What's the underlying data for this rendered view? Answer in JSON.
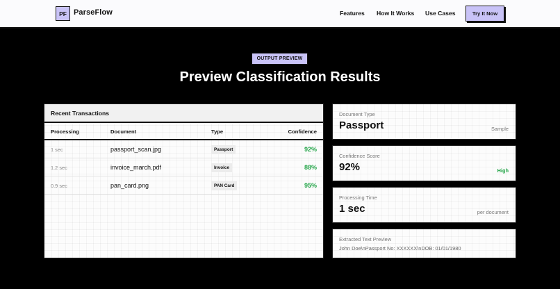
{
  "nav": {
    "logo_initials": "PF",
    "brand": "ParseFlow",
    "links": [
      "Features",
      "How It Works",
      "Use Cases"
    ],
    "cta_label": "Try It Now"
  },
  "hero": {
    "badge": "OUTPUT PREVIEW",
    "title": "Preview Classification Results"
  },
  "table": {
    "title": "Recent Transactions",
    "headers": [
      "Processing",
      "Document",
      "Type",
      "Confidence"
    ],
    "rows": [
      {
        "processing": "1 sec",
        "document": "passport_scan.jpg",
        "type": "Passport",
        "confidence": "92%"
      },
      {
        "processing": "1.2 sec",
        "document": "invoice_march.pdf",
        "type": "Invoice",
        "confidence": "88%"
      },
      {
        "processing": "0.9 sec",
        "document": "pan_card.png",
        "type": "PAN Card",
        "confidence": "95%"
      }
    ]
  },
  "stats": {
    "doc_type": {
      "label": "Document Type",
      "value": "Passport",
      "side": "Sample"
    },
    "confidence": {
      "label": "Confidence Score",
      "value": "92%",
      "side": "High"
    },
    "processing": {
      "label": "Processing Time",
      "value": "1 sec",
      "side": "per document"
    },
    "extracted": {
      "label": "Extracted Text Preview",
      "text": "John Doe\\nPassport No: XXXXXX\\nDOB: 01/01/1980"
    }
  },
  "colors": {
    "accent": "#c9c3f7",
    "success": "#22a447",
    "background": "#000000"
  }
}
